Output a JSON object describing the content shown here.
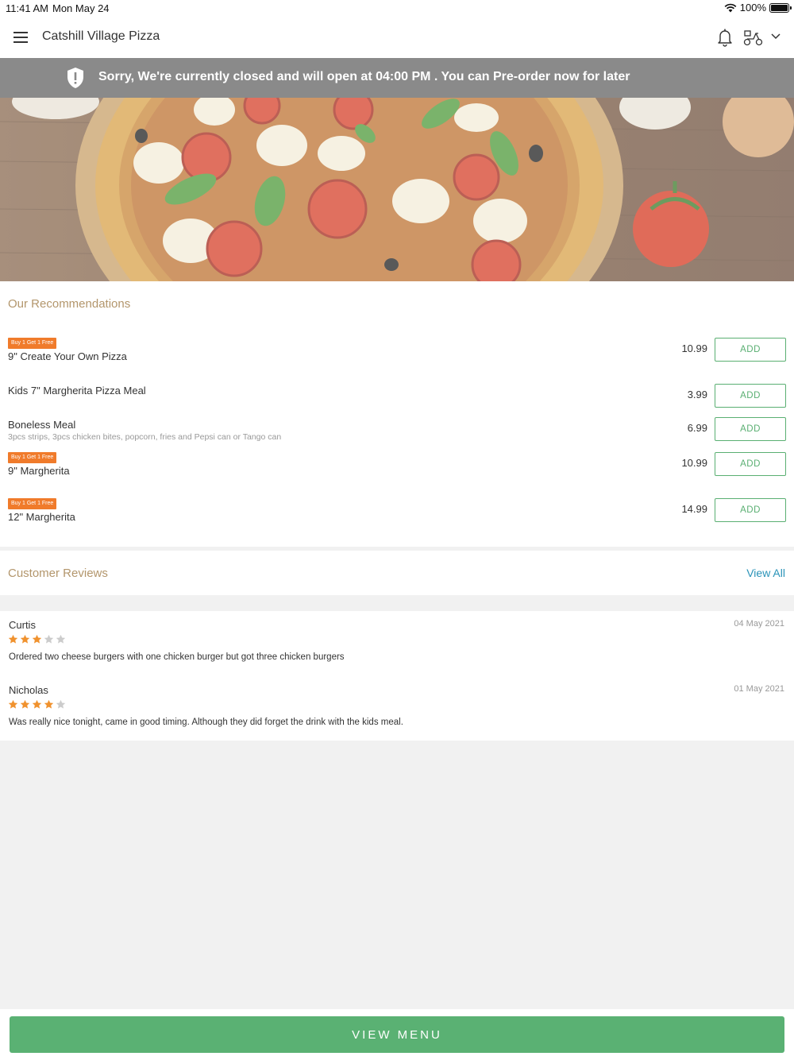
{
  "status_bar": {
    "time": "11:41 AM",
    "date": "Mon May 24",
    "battery": "100%"
  },
  "header": {
    "title": "Catshill Village Pizza"
  },
  "banner": {
    "message": "Sorry, We're currently closed and will open at 04:00 PM . You can Pre-order now for later"
  },
  "recommendations": {
    "title": "Our Recommendations",
    "items": [
      {
        "badge": "Buy 1 Get 1 Free",
        "name": "9\" Create Your Own Pizza",
        "desc": "",
        "price": "10.99",
        "add_label": "ADD"
      },
      {
        "badge": "",
        "name": "Kids 7\" Margherita Pizza Meal",
        "desc": "",
        "price": "3.99",
        "add_label": "ADD"
      },
      {
        "badge": "",
        "name": "Boneless Meal",
        "desc": "3pcs strips, 3pcs chicken bites, popcorn, fries and Pepsi can or Tango can",
        "price": "6.99",
        "add_label": "ADD"
      },
      {
        "badge": "Buy 1 Get 1 Free",
        "name": "9\" Margherita",
        "desc": "",
        "price": "10.99",
        "add_label": "ADD"
      },
      {
        "badge": "Buy 1 Get 1 Free",
        "name": "12\" Margherita",
        "desc": "",
        "price": "14.99",
        "add_label": "ADD"
      }
    ]
  },
  "reviews": {
    "title": "Customer Reviews",
    "view_all": "View All",
    "items": [
      {
        "name": "Curtis",
        "date": "04 May 2021",
        "rating": 3,
        "max_rating": 5,
        "text": "Ordered two cheese burgers with one chicken burger but got three chicken burgers"
      },
      {
        "name": "Nicholas",
        "date": "01 May 2021",
        "rating": 4,
        "max_rating": 5,
        "text": "Was really nice tonight, came in good timing. Although they did forget the drink with the kids meal."
      }
    ]
  },
  "footer": {
    "view_menu": "VIEW MENU"
  },
  "colors": {
    "accent_green": "#5ab173",
    "section_title": "#b3966c",
    "badge_orange": "#f07b2b",
    "link_blue": "#2a93b8",
    "star_filled": "#f0922e",
    "star_empty": "#cccccc",
    "banner_bg": "#8a8a8a"
  },
  "icons": {
    "menu": "hamburger-menu-icon",
    "bell": "bell-icon",
    "delivery": "scooter-icon",
    "dropdown": "chevron-down-icon",
    "banner": "shield-alert-icon",
    "wifi": "wifi-icon",
    "battery": "battery-icon"
  }
}
